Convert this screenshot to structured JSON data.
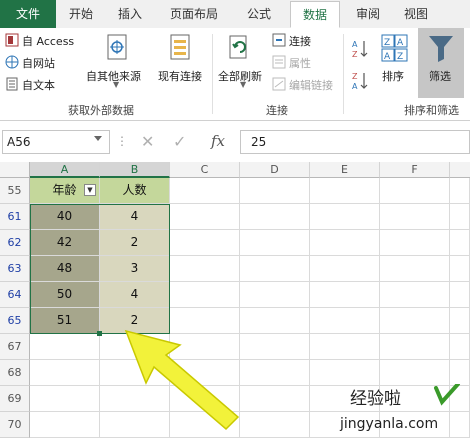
{
  "tabs": [
    {
      "label": "文件",
      "kind": "file"
    },
    {
      "label": "开始",
      "kind": "normal"
    },
    {
      "label": "插入",
      "kind": "normal"
    },
    {
      "label": "页面布局",
      "kind": "normal"
    },
    {
      "label": "公式",
      "kind": "normal"
    },
    {
      "label": "数据",
      "kind": "active"
    },
    {
      "label": "审阅",
      "kind": "normal"
    },
    {
      "label": "视图",
      "kind": "normal"
    }
  ],
  "ribbon": {
    "get_external": {
      "access": "自 Access",
      "web": "自网站",
      "text": "自文本",
      "other_sources": "自其他来源",
      "existing": "现有连接",
      "group_label": "获取外部数据"
    },
    "connections": {
      "refresh_all": "全部刷新",
      "connections": "连接",
      "properties": "属性",
      "edit_links": "编辑链接",
      "group_label": "连接"
    },
    "sort_filter": {
      "sort": "排序",
      "filter": "筛选",
      "group_label": "排序和筛选"
    }
  },
  "formula_bar": {
    "name_box": "A56",
    "value": "25"
  },
  "columns": [
    "A",
    "B",
    "C",
    "D",
    "E",
    "F"
  ],
  "rows": [
    {
      "num": "55",
      "a": "年龄",
      "b": "人数",
      "header": true
    },
    {
      "num": "61",
      "a": "40",
      "b": "4"
    },
    {
      "num": "62",
      "a": "42",
      "b": "2"
    },
    {
      "num": "63",
      "a": "48",
      "b": "3"
    },
    {
      "num": "64",
      "a": "50",
      "b": "4"
    },
    {
      "num": "65",
      "a": "51",
      "b": "2"
    },
    {
      "num": "67",
      "a": "",
      "b": ""
    },
    {
      "num": "68",
      "a": "",
      "b": ""
    },
    {
      "num": "69",
      "a": "",
      "b": ""
    },
    {
      "num": "70",
      "a": "",
      "b": ""
    }
  ],
  "colors": {
    "accent": "#217346",
    "filtered_row_number": "#1f3fa6",
    "header_fill": "#c4d79b",
    "col_a_fill": "#a6a68c",
    "col_b_fill": "#d9d7be",
    "arrow": "#f2f23a"
  },
  "watermark": {
    "line1": "经验啦",
    "line2": "jingyanla.com"
  }
}
